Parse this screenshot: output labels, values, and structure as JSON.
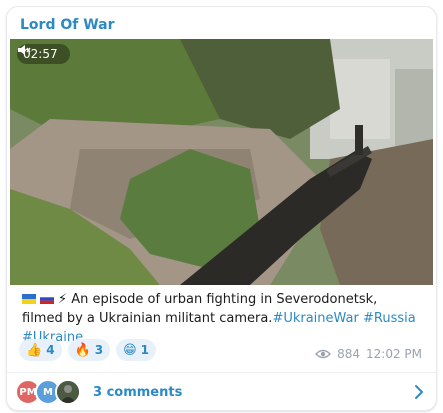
{
  "channel": {
    "name": "Lord Of War"
  },
  "video": {
    "duration": "02:57",
    "muted_icon": "speaker-muted-icon"
  },
  "caption": {
    "flag_ua": "ukraine-flag-icon",
    "flag_ru": "russia-flag-icon",
    "bolt": "⚡",
    "text": "An episode of urban fighting in Severodonetsk, filmed by a Ukrainian militant camera.",
    "hashtags": [
      "#UkraineWar",
      "#Russia",
      "#Ukraine"
    ]
  },
  "reactions": [
    {
      "emoji": "👍",
      "count": "4"
    },
    {
      "emoji": "🔥",
      "count": "3"
    },
    {
      "emoji": "😁",
      "count": "1"
    }
  ],
  "meta": {
    "views": "884",
    "time": "12:02 PM"
  },
  "comments": {
    "avatars": [
      {
        "initials": "PM",
        "color": "#e06666"
      },
      {
        "initials": "M",
        "color": "#5a9fdc"
      },
      {
        "initials": "",
        "color": "#4d5a43"
      }
    ],
    "label": "3 comments"
  },
  "colors": {
    "accent": "#2b8ac4",
    "reaction_bg": "#e8f1fa",
    "muted": "#9aa3ad"
  }
}
